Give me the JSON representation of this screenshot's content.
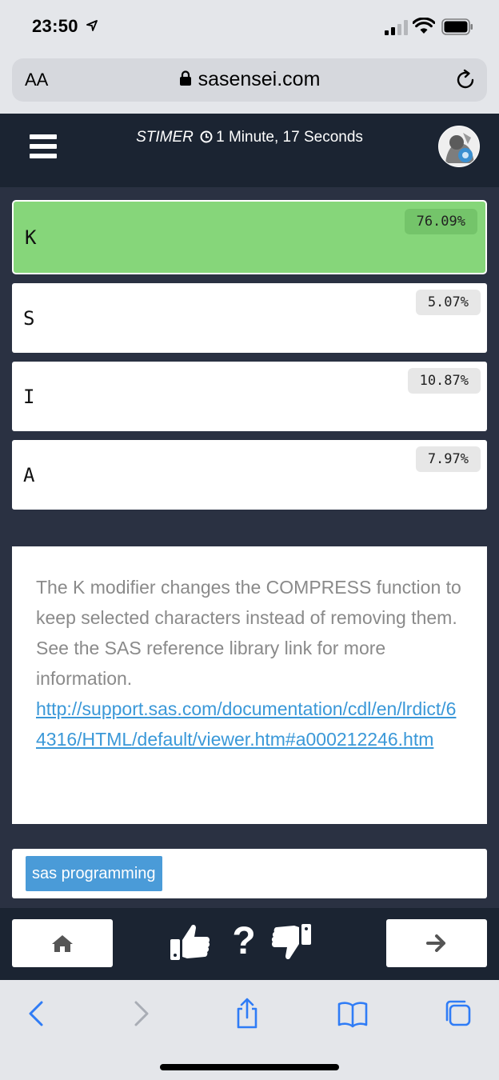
{
  "status_bar": {
    "time": "23:50"
  },
  "browser": {
    "aa_label": "AA",
    "url": "sasensei.com"
  },
  "nav": {
    "brand": "STIMER",
    "timer_text": "1 Minute, 17 Seconds"
  },
  "answers": [
    {
      "letter": "K",
      "percent": "76.09%",
      "correct": true
    },
    {
      "letter": "S",
      "percent": "5.07%",
      "correct": false
    },
    {
      "letter": "I",
      "percent": "10.87%",
      "correct": false
    },
    {
      "letter": "A",
      "percent": "7.97%",
      "correct": false
    }
  ],
  "explanation": {
    "text": "The K modifier changes the COMPRESS function to keep selected characters instead of removing them.  See the SAS reference library link for more information.",
    "link": "http://support.sas.com/documentation/cdl/en/lrdict/64316/HTML/default/viewer.htm#a000212246.htm"
  },
  "tags": [
    "sas programming"
  ],
  "actions": {
    "question_mark": "?"
  },
  "colors": {
    "correct": "#86d67a",
    "nav": "#1b2432",
    "page": "#2a3142",
    "tag": "#4a9bd8",
    "link": "#3a98d8",
    "ios_blue": "#2f7cf6"
  }
}
